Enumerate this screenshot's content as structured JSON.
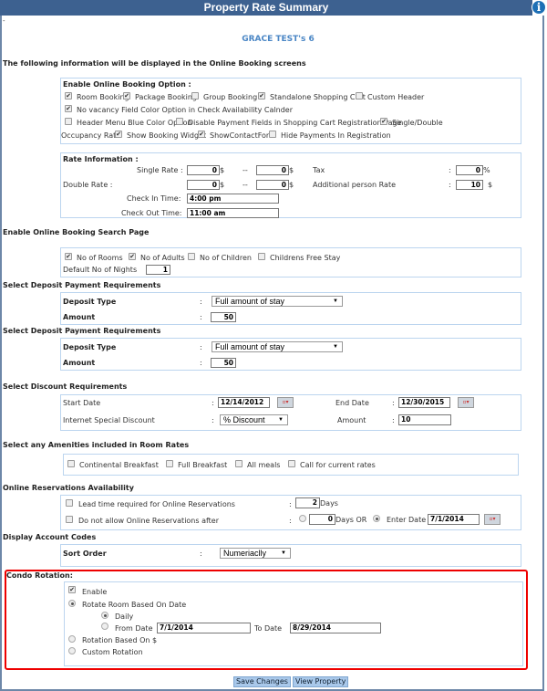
{
  "header": {
    "title": "Property Rate Summary",
    "info_icon": "info-icon"
  },
  "property_name": "GRACE TEST's 6",
  "intro": "The following information will be displayed in the Online Booking screens",
  "booking_options": {
    "title": "Enable Online Booking Option :",
    "items": [
      {
        "label": "Room Booking",
        "checked": true
      },
      {
        "label": "Package Booking",
        "checked": true
      },
      {
        "label": "Group Booking",
        "checked": false
      },
      {
        "label": "Standalone Shopping Cart",
        "checked": true
      },
      {
        "label": "Custom Header",
        "checked": false
      },
      {
        "label": "No vacancy Field Color Option in Check Availability Calnder",
        "checked": true
      },
      {
        "label": "Header Menu Blue Color Option",
        "checked": false
      },
      {
        "label": "Disable Payment Fields in Shopping Cart Registration Page",
        "checked": false
      },
      {
        "label": "Single/Double",
        "checked": true
      },
      {
        "label": "Occupancy Rate",
        "checked": null
      },
      {
        "label": "Show Booking Widget",
        "checked": true
      },
      {
        "label": "ShowContactForm",
        "checked": true
      },
      {
        "label": "Hide Payments In Registration",
        "checked": false
      }
    ]
  },
  "rate": {
    "title": "Rate Information :",
    "single_label": "Single Rate :",
    "single_from": "0",
    "single_to": "0",
    "double_label": "Double Rate :",
    "double_from": "0",
    "double_to": "0",
    "sep": "--",
    "currency": "$",
    "tax_label": "Tax",
    "tax": "0",
    "percent": "%",
    "colon": ":",
    "add_label": "Additional person Rate",
    "add": "10",
    "checkin_label": "Check In Time:",
    "checkin": "4:00 pm",
    "checkout_label": "Check Out Time:",
    "checkout": "11:00 am"
  },
  "search": {
    "title": "Enable Online Booking Search Page",
    "items": [
      {
        "label": "No of Rooms",
        "checked": true
      },
      {
        "label": "No of Adults",
        "checked": true
      },
      {
        "label": "No of Children",
        "checked": false
      },
      {
        "label": "Childrens Free Stay",
        "checked": false
      }
    ],
    "nights_label": "Default No of Nights",
    "nights": "1"
  },
  "deposits": [
    {
      "title": "Select Deposit Payment Requirements",
      "type_label": "Deposit Type",
      "type": "Full amount of stay",
      "amount_label": "Amount",
      "amount": "50"
    },
    {
      "title": "Select Deposit Payment Requirements",
      "type_label": "Deposit Type",
      "type": "Full amount of stay",
      "amount_label": "Amount",
      "amount": "50"
    }
  ],
  "discount": {
    "title": "Select Discount Requirements",
    "start_label": "Start Date",
    "start": "12/14/2012",
    "end_label": "End Date",
    "end": "12/30/2015",
    "isd_label": "Internet Special Discount",
    "isd": "% Discount",
    "amount_label": "Amount",
    "amount": "10"
  },
  "amenities": {
    "title": "Select any Amenities included in Room Rates",
    "items": [
      {
        "label": "Continental Breakfast",
        "checked": false
      },
      {
        "label": "Full Breakfast",
        "checked": false
      },
      {
        "label": "All meals",
        "checked": false
      },
      {
        "label": "Call for current rates",
        "checked": false
      }
    ]
  },
  "availability": {
    "title": "Online Reservations Availability",
    "lead_label": "Lead time required for Online Reservations",
    "lead": "2",
    "days": "Days",
    "after_label": "Do not allow Online Reservations after",
    "after_days": "0",
    "days_or": "Days OR",
    "enter_date_label": "Enter Date",
    "enter_date": "7/1/2014"
  },
  "account_codes": {
    "title": "Display Account Codes",
    "sort_label": "Sort Order",
    "sort": "Numeriaclly"
  },
  "condo": {
    "title": "Condo Rotation:",
    "enable": "Enable",
    "rotate_date": "Rotate Room Based On Date",
    "daily": "Daily",
    "from_label": "From Date",
    "from": "7/1/2014",
    "to_label": "To Date",
    "to": "8/29/2014",
    "based_money": "Rotation Based On $",
    "custom": "Custom Rotation",
    "selected": "Rotate Room Based On Date",
    "sub_selected": "Daily"
  },
  "buttons": {
    "save": "Save Changes",
    "view": "View Property"
  },
  "colors": {
    "header": "#3d6190",
    "highlight": "#e00000",
    "title": "#4a86c5"
  }
}
